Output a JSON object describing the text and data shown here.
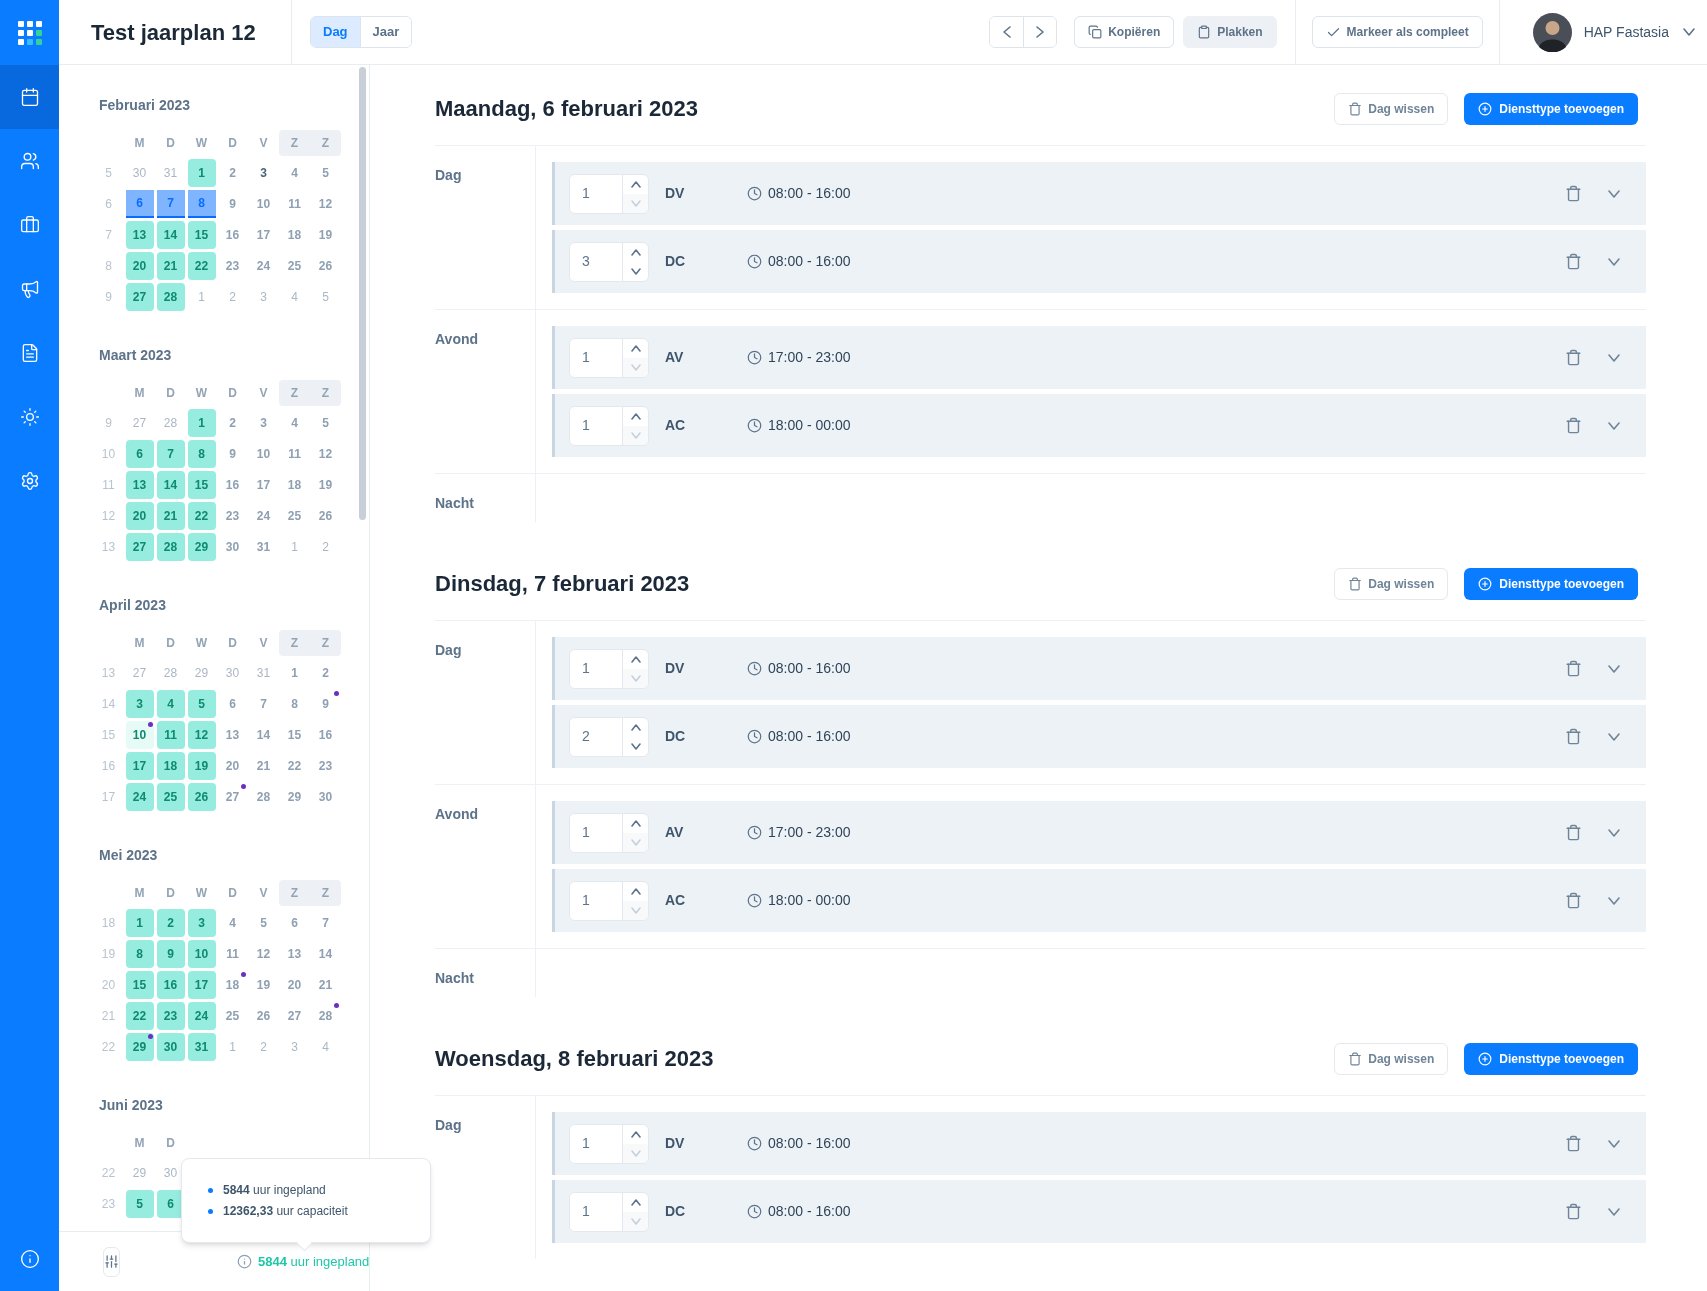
{
  "rail": [
    {
      "selected": true
    },
    {
      "selected": false
    },
    {
      "selected": false
    },
    {
      "selected": false
    },
    {
      "selected": false
    },
    {
      "selected": false
    },
    {
      "selected": false
    }
  ],
  "header": {
    "title": "Test jaarplan 12",
    "views": [
      {
        "label": "Dag",
        "selected": true
      },
      {
        "label": "Jaar",
        "selected": false
      }
    ],
    "actions": [
      {
        "label": "Kopiëren",
        "kind": "copy",
        "filled": false
      },
      {
        "label": "Plakken",
        "kind": "paste",
        "filled": true
      }
    ],
    "complete_button": "Markeer als compleet",
    "user": "HAP Fastasia"
  },
  "calendar": {
    "months": [
      {
        "title": "Februari 2023",
        "weekdays": [
          {
            "label": "M",
            "weekend": false
          },
          {
            "label": "D",
            "weekend": false
          },
          {
            "label": "W",
            "weekend": false
          },
          {
            "label": "D",
            "weekend": false
          },
          {
            "label": "V",
            "weekend": false
          },
          {
            "label": "Z",
            "weekend": true
          },
          {
            "label": "Z",
            "weekend": true
          }
        ],
        "weeks": [
          {
            "number": "5",
            "days": [
              {
                "d": "30",
                "kind": "muted",
                "dot": false
              },
              {
                "d": "31",
                "kind": "muted",
                "dot": false
              },
              {
                "d": "1",
                "kind": "planned",
                "dot": false
              },
              {
                "d": "2",
                "kind": "plain",
                "dot": false
              },
              {
                "d": "3",
                "kind": "today",
                "dot": false
              },
              {
                "d": "4",
                "kind": "plain",
                "dot": false
              },
              {
                "d": "5",
                "kind": "plain",
                "dot": false
              }
            ]
          },
          {
            "number": "6",
            "days": [
              {
                "d": "6",
                "kind": "selected",
                "dot": false
              },
              {
                "d": "7",
                "kind": "selected",
                "dot": false
              },
              {
                "d": "8",
                "kind": "selected",
                "dot": false
              },
              {
                "d": "9",
                "kind": "plain",
                "dot": false
              },
              {
                "d": "10",
                "kind": "plain",
                "dot": false
              },
              {
                "d": "11",
                "kind": "plain",
                "dot": false
              },
              {
                "d": "12",
                "kind": "plain",
                "dot": false
              }
            ]
          },
          {
            "number": "7",
            "days": [
              {
                "d": "13",
                "kind": "planned",
                "dot": false
              },
              {
                "d": "14",
                "kind": "planned",
                "dot": false
              },
              {
                "d": "15",
                "kind": "planned",
                "dot": false
              },
              {
                "d": "16",
                "kind": "plain",
                "dot": false
              },
              {
                "d": "17",
                "kind": "plain",
                "dot": false
              },
              {
                "d": "18",
                "kind": "plain",
                "dot": false
              },
              {
                "d": "19",
                "kind": "plain",
                "dot": false
              }
            ]
          },
          {
            "number": "8",
            "days": [
              {
                "d": "20",
                "kind": "planned",
                "dot": false
              },
              {
                "d": "21",
                "kind": "planned",
                "dot": false
              },
              {
                "d": "22",
                "kind": "planned",
                "dot": false
              },
              {
                "d": "23",
                "kind": "plain",
                "dot": false
              },
              {
                "d": "24",
                "kind": "plain",
                "dot": false
              },
              {
                "d": "25",
                "kind": "plain",
                "dot": false
              },
              {
                "d": "26",
                "kind": "plain",
                "dot": false
              }
            ]
          },
          {
            "number": "9",
            "days": [
              {
                "d": "27",
                "kind": "planned",
                "dot": false
              },
              {
                "d": "28",
                "kind": "planned",
                "dot": false
              },
              {
                "d": "1",
                "kind": "muted",
                "dot": false
              },
              {
                "d": "2",
                "kind": "muted",
                "dot": false
              },
              {
                "d": "3",
                "kind": "muted",
                "dot": false
              },
              {
                "d": "4",
                "kind": "muted",
                "dot": false
              },
              {
                "d": "5",
                "kind": "muted",
                "dot": false
              }
            ]
          }
        ]
      },
      {
        "title": "Maart 2023",
        "weekdays": [
          {
            "label": "M",
            "weekend": false
          },
          {
            "label": "D",
            "weekend": false
          },
          {
            "label": "W",
            "weekend": false
          },
          {
            "label": "D",
            "weekend": false
          },
          {
            "label": "V",
            "weekend": false
          },
          {
            "label": "Z",
            "weekend": true
          },
          {
            "label": "Z",
            "weekend": true
          }
        ],
        "weeks": [
          {
            "number": "9",
            "days": [
              {
                "d": "27",
                "kind": "muted",
                "dot": false
              },
              {
                "d": "28",
                "kind": "muted",
                "dot": false
              },
              {
                "d": "1",
                "kind": "planned",
                "dot": false
              },
              {
                "d": "2",
                "kind": "plain",
                "dot": false
              },
              {
                "d": "3",
                "kind": "plain",
                "dot": false
              },
              {
                "d": "4",
                "kind": "plain",
                "dot": false
              },
              {
                "d": "5",
                "kind": "plain",
                "dot": false
              }
            ]
          },
          {
            "number": "10",
            "days": [
              {
                "d": "6",
                "kind": "planned",
                "dot": false
              },
              {
                "d": "7",
                "kind": "planned",
                "dot": false
              },
              {
                "d": "8",
                "kind": "planned",
                "dot": false
              },
              {
                "d": "9",
                "kind": "plain",
                "dot": false
              },
              {
                "d": "10",
                "kind": "plain",
                "dot": false
              },
              {
                "d": "11",
                "kind": "plain",
                "dot": false
              },
              {
                "d": "12",
                "kind": "plain",
                "dot": false
              }
            ]
          },
          {
            "number": "11",
            "days": [
              {
                "d": "13",
                "kind": "planned",
                "dot": false
              },
              {
                "d": "14",
                "kind": "planned",
                "dot": false
              },
              {
                "d": "15",
                "kind": "planned",
                "dot": false
              },
              {
                "d": "16",
                "kind": "plain",
                "dot": false
              },
              {
                "d": "17",
                "kind": "plain",
                "dot": false
              },
              {
                "d": "18",
                "kind": "plain",
                "dot": false
              },
              {
                "d": "19",
                "kind": "plain",
                "dot": false
              }
            ]
          },
          {
            "number": "12",
            "days": [
              {
                "d": "20",
                "kind": "planned",
                "dot": false
              },
              {
                "d": "21",
                "kind": "planned",
                "dot": false
              },
              {
                "d": "22",
                "kind": "planned",
                "dot": false
              },
              {
                "d": "23",
                "kind": "plain",
                "dot": false
              },
              {
                "d": "24",
                "kind": "plain",
                "dot": false
              },
              {
                "d": "25",
                "kind": "plain",
                "dot": false
              },
              {
                "d": "26",
                "kind": "plain",
                "dot": false
              }
            ]
          },
          {
            "number": "13",
            "days": [
              {
                "d": "27",
                "kind": "planned",
                "dot": false
              },
              {
                "d": "28",
                "kind": "planned",
                "dot": false
              },
              {
                "d": "29",
                "kind": "planned",
                "dot": false
              },
              {
                "d": "30",
                "kind": "plain",
                "dot": false
              },
              {
                "d": "31",
                "kind": "plain",
                "dot": false
              },
              {
                "d": "1",
                "kind": "muted",
                "dot": false
              },
              {
                "d": "2",
                "kind": "muted",
                "dot": false
              }
            ]
          }
        ]
      },
      {
        "title": "April 2023",
        "weekdays": [
          {
            "label": "M",
            "weekend": false
          },
          {
            "label": "D",
            "weekend": false
          },
          {
            "label": "W",
            "weekend": false
          },
          {
            "label": "D",
            "weekend": false
          },
          {
            "label": "V",
            "weekend": false
          },
          {
            "label": "Z",
            "weekend": true
          },
          {
            "label": "Z",
            "weekend": true
          }
        ],
        "weeks": [
          {
            "number": "13",
            "days": [
              {
                "d": "27",
                "kind": "muted",
                "dot": false
              },
              {
                "d": "28",
                "kind": "muted",
                "dot": false
              },
              {
                "d": "29",
                "kind": "muted",
                "dot": false
              },
              {
                "d": "30",
                "kind": "muted",
                "dot": false
              },
              {
                "d": "31",
                "kind": "muted",
                "dot": false
              },
              {
                "d": "1",
                "kind": "plain",
                "dot": false
              },
              {
                "d": "2",
                "kind": "plain",
                "dot": false
              }
            ]
          },
          {
            "number": "14",
            "days": [
              {
                "d": "3",
                "kind": "planned",
                "dot": false
              },
              {
                "d": "4",
                "kind": "planned",
                "dot": false
              },
              {
                "d": "5",
                "kind": "planned",
                "dot": false
              },
              {
                "d": "6",
                "kind": "plain",
                "dot": false
              },
              {
                "d": "7",
                "kind": "plain",
                "dot": false
              },
              {
                "d": "8",
                "kind": "plain",
                "dot": false
              },
              {
                "d": "9",
                "kind": "plain",
                "dot": true
              }
            ]
          },
          {
            "number": "15",
            "days": [
              {
                "d": "10",
                "kind": "partial",
                "dot": true
              },
              {
                "d": "11",
                "kind": "planned",
                "dot": false
              },
              {
                "d": "12",
                "kind": "planned",
                "dot": false
              },
              {
                "d": "13",
                "kind": "plain",
                "dot": false
              },
              {
                "d": "14",
                "kind": "plain",
                "dot": false
              },
              {
                "d": "15",
                "kind": "plain",
                "dot": false
              },
              {
                "d": "16",
                "kind": "plain",
                "dot": false
              }
            ]
          },
          {
            "number": "16",
            "days": [
              {
                "d": "17",
                "kind": "planned",
                "dot": false
              },
              {
                "d": "18",
                "kind": "planned",
                "dot": false
              },
              {
                "d": "19",
                "kind": "planned",
                "dot": false
              },
              {
                "d": "20",
                "kind": "plain",
                "dot": false
              },
              {
                "d": "21",
                "kind": "plain",
                "dot": false
              },
              {
                "d": "22",
                "kind": "plain",
                "dot": false
              },
              {
                "d": "23",
                "kind": "plain",
                "dot": false
              }
            ]
          },
          {
            "number": "17",
            "days": [
              {
                "d": "24",
                "kind": "planned",
                "dot": false
              },
              {
                "d": "25",
                "kind": "planned",
                "dot": false
              },
              {
                "d": "26",
                "kind": "planned",
                "dot": false
              },
              {
                "d": "27",
                "kind": "plain",
                "dot": true
              },
              {
                "d": "28",
                "kind": "plain",
                "dot": false
              },
              {
                "d": "29",
                "kind": "plain",
                "dot": false
              },
              {
                "d": "30",
                "kind": "plain",
                "dot": false
              }
            ]
          }
        ]
      },
      {
        "title": "Mei 2023",
        "weekdays": [
          {
            "label": "M",
            "weekend": false
          },
          {
            "label": "D",
            "weekend": false
          },
          {
            "label": "W",
            "weekend": false
          },
          {
            "label": "D",
            "weekend": false
          },
          {
            "label": "V",
            "weekend": false
          },
          {
            "label": "Z",
            "weekend": true
          },
          {
            "label": "Z",
            "weekend": true
          }
        ],
        "weeks": [
          {
            "number": "18",
            "days": [
              {
                "d": "1",
                "kind": "planned",
                "dot": false
              },
              {
                "d": "2",
                "kind": "planned",
                "dot": false
              },
              {
                "d": "3",
                "kind": "planned",
                "dot": false
              },
              {
                "d": "4",
                "kind": "plain",
                "dot": false
              },
              {
                "d": "5",
                "kind": "plain",
                "dot": false
              },
              {
                "d": "6",
                "kind": "plain",
                "dot": false
              },
              {
                "d": "7",
                "kind": "plain",
                "dot": false
              }
            ]
          },
          {
            "number": "19",
            "days": [
              {
                "d": "8",
                "kind": "planned",
                "dot": false
              },
              {
                "d": "9",
                "kind": "planned",
                "dot": false
              },
              {
                "d": "10",
                "kind": "planned",
                "dot": false
              },
              {
                "d": "11",
                "kind": "plain",
                "dot": false
              },
              {
                "d": "12",
                "kind": "plain",
                "dot": false
              },
              {
                "d": "13",
                "kind": "plain",
                "dot": false
              },
              {
                "d": "14",
                "kind": "plain",
                "dot": false
              }
            ]
          },
          {
            "number": "20",
            "days": [
              {
                "d": "15",
                "kind": "planned",
                "dot": false
              },
              {
                "d": "16",
                "kind": "planned",
                "dot": false
              },
              {
                "d": "17",
                "kind": "planned",
                "dot": false
              },
              {
                "d": "18",
                "kind": "plain",
                "dot": true
              },
              {
                "d": "19",
                "kind": "plain",
                "dot": false
              },
              {
                "d": "20",
                "kind": "plain",
                "dot": false
              },
              {
                "d": "21",
                "kind": "plain",
                "dot": false
              }
            ]
          },
          {
            "number": "21",
            "days": [
              {
                "d": "22",
                "kind": "planned",
                "dot": false
              },
              {
                "d": "23",
                "kind": "planned",
                "dot": false
              },
              {
                "d": "24",
                "kind": "planned",
                "dot": false
              },
              {
                "d": "25",
                "kind": "plain",
                "dot": false
              },
              {
                "d": "26",
                "kind": "plain",
                "dot": false
              },
              {
                "d": "27",
                "kind": "plain",
                "dot": false
              },
              {
                "d": "28",
                "kind": "plain",
                "dot": true
              }
            ]
          },
          {
            "number": "22",
            "days": [
              {
                "d": "29",
                "kind": "planned",
                "dot": true
              },
              {
                "d": "30",
                "kind": "planned",
                "dot": false
              },
              {
                "d": "31",
                "kind": "planned",
                "dot": false
              },
              {
                "d": "1",
                "kind": "muted",
                "dot": false
              },
              {
                "d": "2",
                "kind": "muted",
                "dot": false
              },
              {
                "d": "3",
                "kind": "muted",
                "dot": false
              },
              {
                "d": "4",
                "kind": "muted",
                "dot": false
              }
            ]
          }
        ]
      },
      {
        "title": "Juni 2023",
        "weekdays": [
          {
            "label": "M",
            "weekend": false
          },
          {
            "label": "D",
            "weekend": false
          }
        ],
        "weeks": [
          {
            "number": "22",
            "days": [
              {
                "d": "29",
                "kind": "muted",
                "dot": false
              },
              {
                "d": "30",
                "kind": "muted",
                "dot": false
              }
            ]
          },
          {
            "number": "23",
            "days": [
              {
                "d": "5",
                "kind": "planned",
                "dot": false
              },
              {
                "d": "6",
                "kind": "planned",
                "dot": false
              }
            ]
          }
        ]
      }
    ]
  },
  "footer": {
    "planned_link": "**5844** uur ingepland",
    "tooltip": [
      "**5844** uur ingepland",
      "**12362,33** uur capaciteit"
    ]
  },
  "days": [
    {
      "title": "Maandag, 6 februari 2023",
      "clear_button": "Dag wissen",
      "add_button": "Diensttype toevoegen",
      "sections": [
        {
          "label": "Dag",
          "shifts": [
            {
              "count": "1",
              "decrease_disabled": true,
              "code": "DV",
              "time": "08:00 - 16:00"
            },
            {
              "count": "3",
              "decrease_disabled": false,
              "code": "DC",
              "time": "08:00 - 16:00"
            }
          ]
        },
        {
          "label": "Avond",
          "shifts": [
            {
              "count": "1",
              "decrease_disabled": true,
              "code": "AV",
              "time": "17:00 - 23:00"
            },
            {
              "count": "1",
              "decrease_disabled": true,
              "code": "AC",
              "time": "18:00 - 00:00"
            }
          ]
        },
        {
          "label": "Nacht"
        }
      ]
    },
    {
      "title": "Dinsdag, 7 februari 2023",
      "clear_button": "Dag wissen",
      "add_button": "Diensttype toevoegen",
      "sections": [
        {
          "label": "Dag",
          "shifts": [
            {
              "count": "1",
              "decrease_disabled": true,
              "code": "DV",
              "time": "08:00 - 16:00"
            },
            {
              "count": "2",
              "decrease_disabled": false,
              "code": "DC",
              "time": "08:00 - 16:00"
            }
          ]
        },
        {
          "label": "Avond",
          "shifts": [
            {
              "count": "1",
              "decrease_disabled": true,
              "code": "AV",
              "time": "17:00 - 23:00"
            },
            {
              "count": "1",
              "decrease_disabled": true,
              "code": "AC",
              "time": "18:00 - 00:00"
            }
          ]
        },
        {
          "label": "Nacht"
        }
      ]
    },
    {
      "title": "Woensdag, 8 februari 2023",
      "clear_button": "Dag wissen",
      "add_button": "Diensttype toevoegen",
      "sections": [
        {
          "label": "Dag",
          "shifts": [
            {
              "count": "1",
              "decrease_disabled": true,
              "code": "DV",
              "time": "08:00 - 16:00"
            },
            {
              "count": "1",
              "decrease_disabled": true,
              "code": "DC",
              "time": "08:00 - 16:00"
            }
          ]
        }
      ]
    }
  ]
}
